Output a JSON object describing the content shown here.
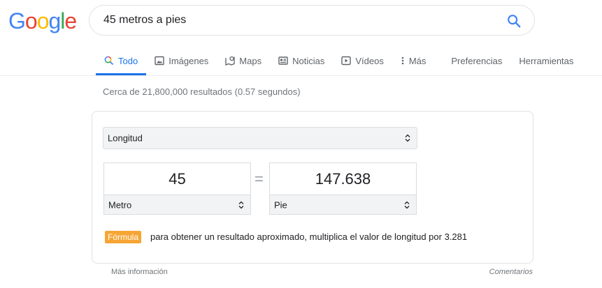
{
  "logo": {
    "letters": [
      "G",
      "o",
      "o",
      "g",
      "l",
      "e"
    ],
    "colors": [
      "#4285f4",
      "#ea4335",
      "#fbbc05",
      "#4285f4",
      "#34a853",
      "#ea4335"
    ]
  },
  "search": {
    "query": "45 metros a pies",
    "icon": "search-icon",
    "icon_color": "#4285f4"
  },
  "tabs": [
    {
      "label": "Todo",
      "icon": "search-icon",
      "active": true
    },
    {
      "label": "Imágenes",
      "icon": "image-icon"
    },
    {
      "label": "Maps",
      "icon": "map-icon"
    },
    {
      "label": "Noticias",
      "icon": "news-icon"
    },
    {
      "label": "Vídeos",
      "icon": "video-icon"
    },
    {
      "label": "Más",
      "icon": "more-icon"
    },
    {
      "label": "Preferencias"
    },
    {
      "label": "Herramientas"
    }
  ],
  "stats": "Cerca de 21,800,000 resultados (0.57 segundos)",
  "converter": {
    "unit_type": "Longitud",
    "from_value": "45",
    "from_unit": "Metro",
    "equals": "=",
    "to_value": "147.638",
    "to_unit": "Pie",
    "formula_label": "Fórmula",
    "formula_text": "para obtener un resultado aproximado, multiplica el valor de longitud por 3.281",
    "formula_color": "#f6a535"
  },
  "footer": {
    "more_info": "Más información",
    "feedback": "Comentarios"
  },
  "accent": "#1a73e8"
}
